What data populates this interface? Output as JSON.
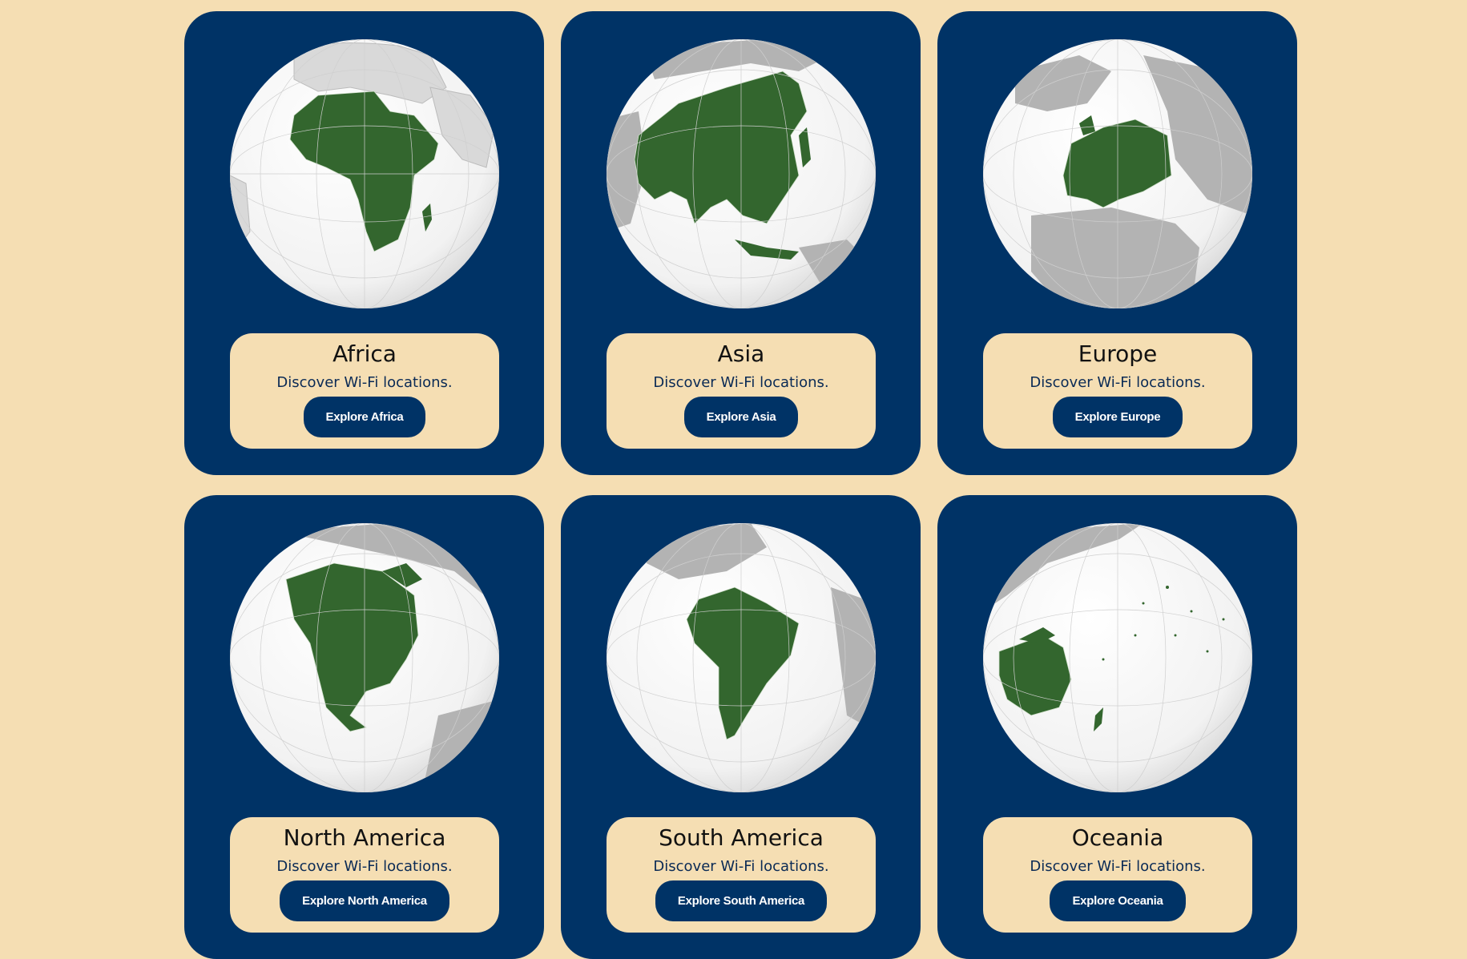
{
  "theme": {
    "page_bg": "#f5deb3",
    "card_bg": "#003366",
    "land_highlight": "#33662e",
    "land_other": "#b3b3b3",
    "ocean": "#ffffff"
  },
  "cards": [
    {
      "name": "Africa",
      "desc": "Discover Wi-Fi locations.",
      "button": "Explore Africa",
      "globe_icon": "globe-africa-icon"
    },
    {
      "name": "Asia",
      "desc": "Discover Wi-Fi locations.",
      "button": "Explore Asia",
      "globe_icon": "globe-asia-icon"
    },
    {
      "name": "Europe",
      "desc": "Discover Wi-Fi locations.",
      "button": "Explore Europe",
      "globe_icon": "globe-europe-icon"
    },
    {
      "name": "North America",
      "desc": "Discover Wi-Fi locations.",
      "button": "Explore North America",
      "globe_icon": "globe-north-america-icon"
    },
    {
      "name": "South America",
      "desc": "Discover Wi-Fi locations.",
      "button": "Explore South America",
      "globe_icon": "globe-south-america-icon"
    },
    {
      "name": "Oceania",
      "desc": "Discover Wi-Fi locations.",
      "button": "Explore Oceania",
      "globe_icon": "globe-oceania-icon"
    }
  ]
}
